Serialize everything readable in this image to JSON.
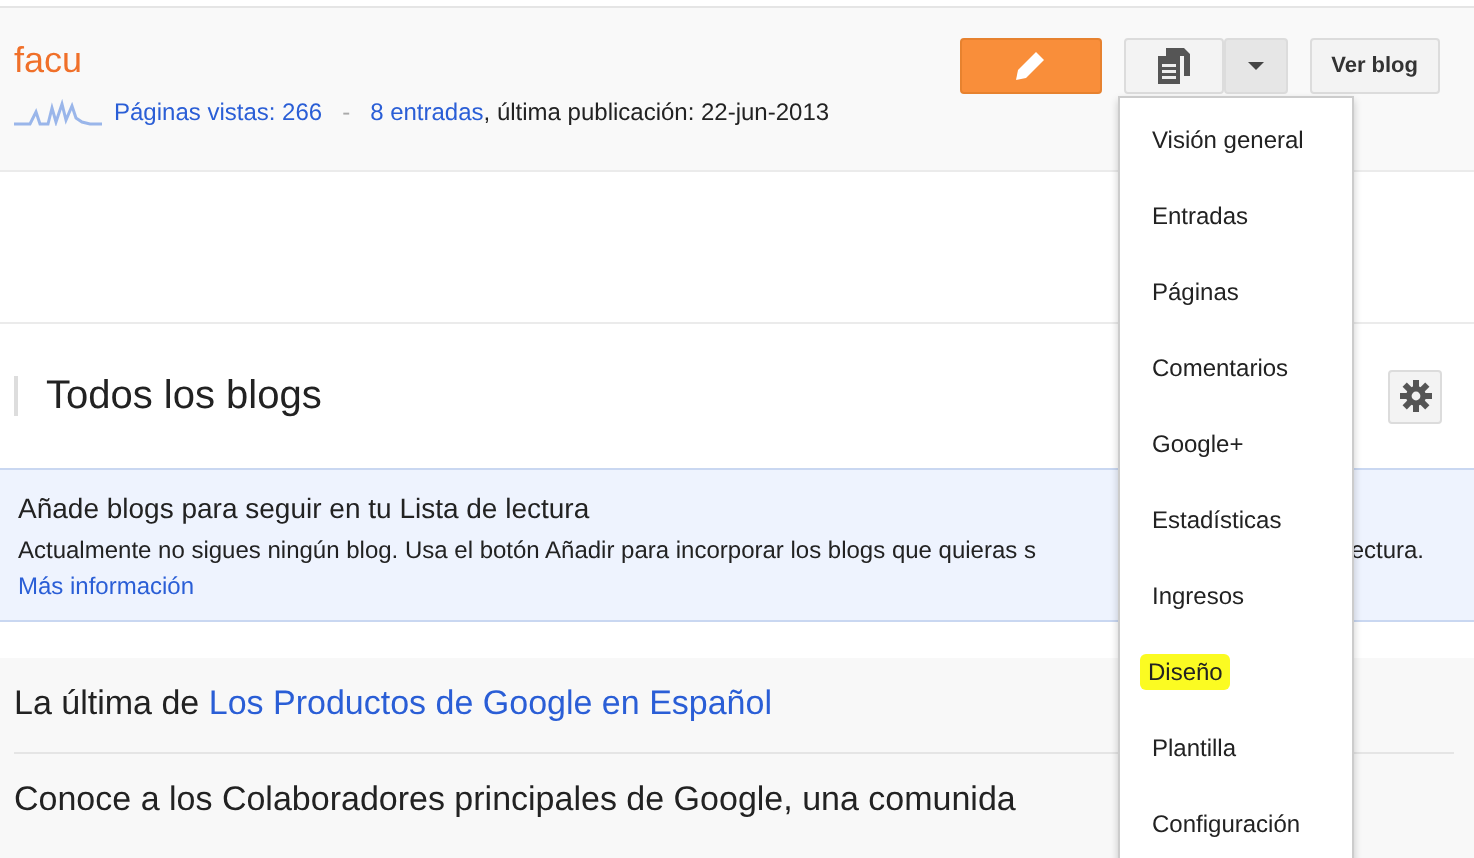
{
  "blog": {
    "title": "facu",
    "pageviews": "Páginas vistas: 266",
    "separator": "-",
    "posts": "8 entradas",
    "last_post": ", última publicación: 22-jun-2013"
  },
  "actions": {
    "view_blog": "Ver blog"
  },
  "menu": [
    {
      "label": "Visión general",
      "highlighted": false
    },
    {
      "label": "Entradas",
      "highlighted": false
    },
    {
      "label": "Páginas",
      "highlighted": false
    },
    {
      "label": "Comentarios",
      "highlighted": false
    },
    {
      "label": "Google+",
      "highlighted": false
    },
    {
      "label": "Estadísticas",
      "highlighted": false
    },
    {
      "label": "Ingresos",
      "highlighted": false
    },
    {
      "label": "Diseño",
      "highlighted": true
    },
    {
      "label": "Plantilla",
      "highlighted": false
    },
    {
      "label": "Configuración",
      "highlighted": false
    }
  ],
  "section": {
    "title": "Todos los blogs"
  },
  "notice": {
    "title": "Añade blogs para seguir en tu Lista de lectura",
    "text_start": "Actualmente no sigues ningún blog. Usa el botón Añadir para incorporar los blogs que quieras s",
    "text_end": "ectura.",
    "link": "Más información"
  },
  "latest": {
    "prefix": "La última de",
    "link": "Los Productos de Google en Español",
    "post": "Conoce a los Colaboradores principales de Google, una comunida"
  }
}
